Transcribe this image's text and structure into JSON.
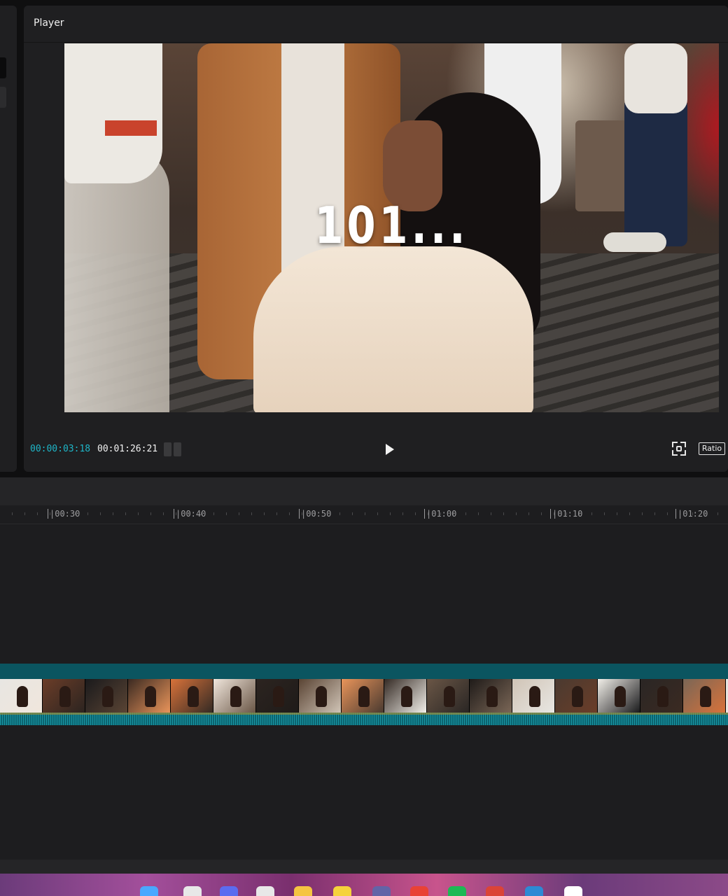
{
  "player": {
    "title": "Player",
    "overlay_text": "101...",
    "timecode_current": "00:00:03:18",
    "timecode_total": "00:01:26:21",
    "ratio_label": "Ratio"
  },
  "timeline": {
    "ruler_labels": [
      "|00:30",
      "|00:40",
      "|00:50",
      "|01:00",
      "|01:10",
      "|01:20"
    ]
  },
  "colors": {
    "accent": "#1eb6c8",
    "panel": "#1f1f21",
    "track": "#0b5560"
  },
  "icons": {
    "play": "play-icon",
    "fullscreen": "fullscreen-icon",
    "ratio": "ratio-icon"
  },
  "taskbar": {
    "apps": [
      "windows-start-icon",
      "file-icon",
      "chat-icon",
      "store-icon",
      "folder-icon",
      "notes-icon",
      "teams-icon",
      "chrome-icon",
      "spotify-icon",
      "chrome-profile-icon",
      "vscode-icon",
      "capcut-icon"
    ]
  }
}
